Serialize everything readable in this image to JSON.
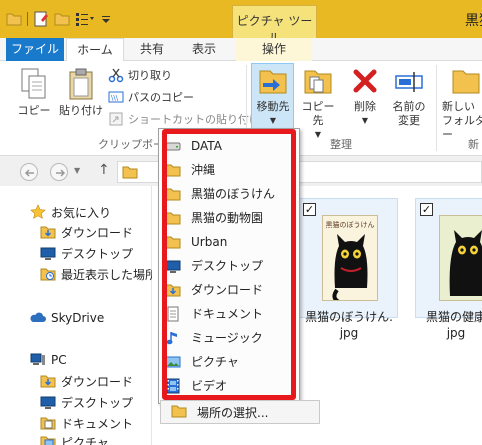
{
  "window": {
    "title": "黒猫",
    "context_tool_label": "ピクチャ ツール"
  },
  "tabs": {
    "file": "ファイル",
    "home": "ホーム",
    "share": "共有",
    "view": "表示",
    "manage": "操作"
  },
  "ribbon": {
    "clipboard": {
      "copy": "コピー",
      "paste": "貼り付け",
      "cut": "切り取り",
      "copy_path": "パスのコピー",
      "paste_shortcut": "ショートカットの貼り付け",
      "group_label": "クリップボード"
    },
    "organize": {
      "move_to": "移動先",
      "copy_to": "コピー先",
      "delete": "削除",
      "rename_line1": "名前の",
      "rename_line2": "変更",
      "group_label": "整理"
    },
    "new": {
      "new_folder_line1": "新しい",
      "new_folder_line2": "フォルダー",
      "group_label": "新"
    }
  },
  "navpane": {
    "items": [
      {
        "label": "お気に入り",
        "icon": "star-icon"
      },
      {
        "label": "ダウンロード",
        "icon": "download-folder-icon"
      },
      {
        "label": "デスクトップ",
        "icon": "desktop-icon"
      },
      {
        "label": "最近表示した場所",
        "icon": "recent-places-icon"
      },
      {
        "label": "SkyDrive",
        "icon": "skydrive-icon"
      },
      {
        "label": "PC",
        "icon": "pc-icon"
      },
      {
        "label": "ダウンロード",
        "icon": "download-folder-icon"
      },
      {
        "label": "デスクトップ",
        "icon": "desktop-icon"
      },
      {
        "label": "ドキュメント",
        "icon": "documents-icon"
      },
      {
        "label": "ピクチャ",
        "icon": "pictures-icon"
      }
    ]
  },
  "files": [
    {
      "name_line1": "黒猫のぼうけん.",
      "name_line2": "jpg",
      "cover_title": "黒猫のぼうけん",
      "checked": true
    },
    {
      "name_line1": "黒猫の健康",
      "name_line2": "jpg",
      "checked": true
    }
  ],
  "move_menu": {
    "items": [
      {
        "label": "DATA",
        "icon": "drive-icon"
      },
      {
        "label": "沖縄",
        "icon": "folder-icon"
      },
      {
        "label": "黒猫のぼうけん",
        "icon": "folder-icon"
      },
      {
        "label": "黒猫の動物園",
        "icon": "folder-icon"
      },
      {
        "label": "Urban",
        "icon": "folder-icon"
      },
      {
        "label": "デスクトップ",
        "icon": "desktop-icon"
      },
      {
        "label": "ダウンロード",
        "icon": "download-folder-icon"
      },
      {
        "label": "ドキュメント",
        "icon": "documents-icon"
      },
      {
        "label": "ミュージック",
        "icon": "music-icon"
      },
      {
        "label": "ピクチャ",
        "icon": "pictures-icon"
      },
      {
        "label": "ビデオ",
        "icon": "video-icon"
      }
    ],
    "choose_location": "場所の選択..."
  },
  "colors": {
    "title_bar": "#e8b923",
    "file_tab": "#1979ca",
    "highlight_frame": "#e8191c",
    "folder": "#f2c14e"
  }
}
